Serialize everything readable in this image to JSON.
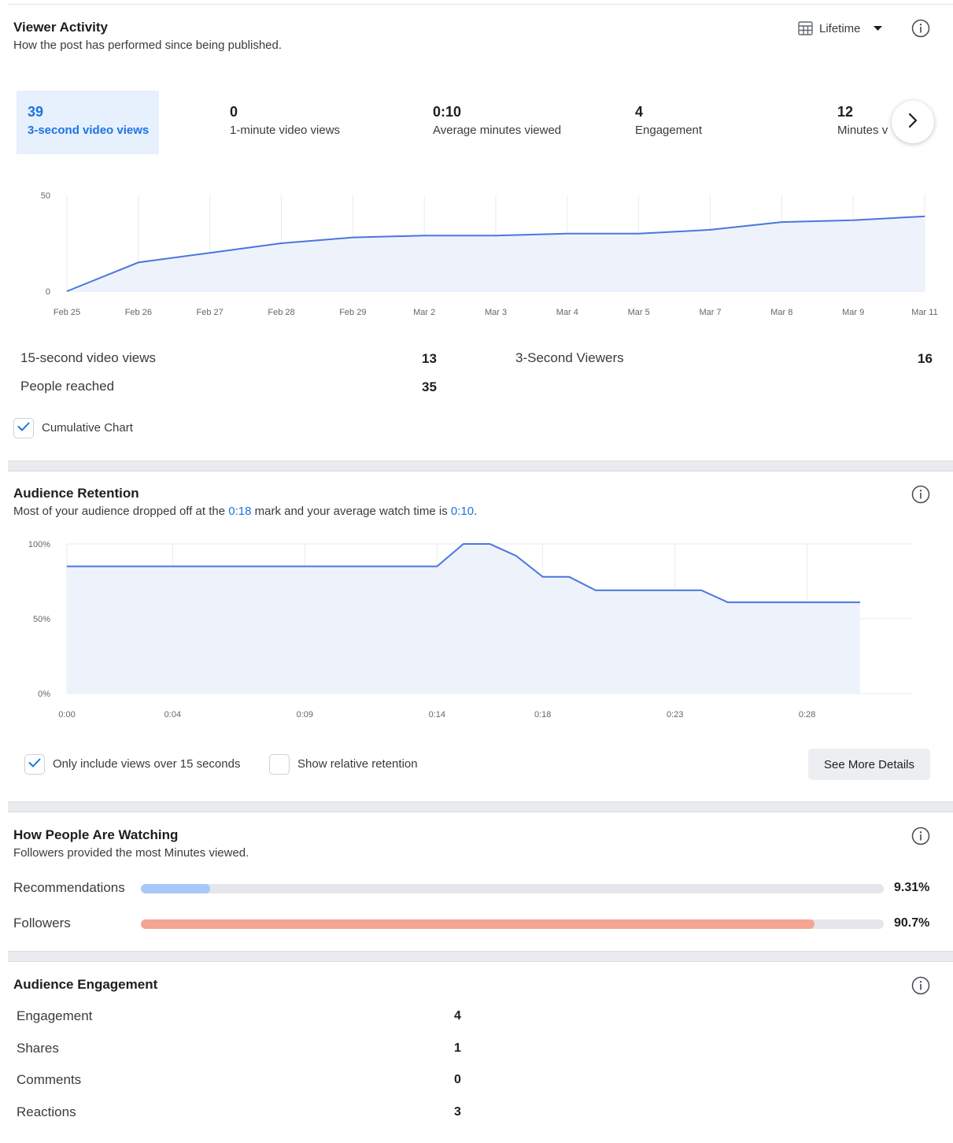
{
  "viewer_activity": {
    "title": "Viewer Activity",
    "subtitle": "How the post has performed since being published.",
    "range_label": "Lifetime",
    "metrics": [
      {
        "value": "39",
        "label": "3-second video views"
      },
      {
        "value": "0",
        "label": "1-minute video views"
      },
      {
        "value": "0:10",
        "label": "Average minutes viewed"
      },
      {
        "value": "4",
        "label": "Engagement"
      },
      {
        "value": "12",
        "label": "Minutes v"
      }
    ],
    "stats": {
      "fifteen_sec_label": "15-second video views",
      "fifteen_sec_value": "13",
      "reached_label": "People reached",
      "reached_value": "35",
      "viewers_label": "3-Second Viewers",
      "viewers_value": "16"
    },
    "cumulative_label": "Cumulative Chart",
    "cumulative_checked": true
  },
  "audience_retention": {
    "title": "Audience Retention",
    "sub_before": "Most of your audience dropped off at the ",
    "sub_mark": "0:18",
    "sub_middle": " mark and your average watch time is ",
    "sub_avg": "0:10",
    "sub_end": ".",
    "only_views_label": "Only include views over 15 seconds",
    "only_views_checked": true,
    "relative_label": "Show relative retention",
    "relative_checked": false,
    "see_more_label": "See More Details"
  },
  "how_watching": {
    "title": "How People Are Watching",
    "subtitle": "Followers provided the most Minutes viewed.",
    "rows": [
      {
        "label": "Recommendations",
        "value": "9.31%",
        "fraction": 0.0931,
        "color": "#a8c7fa"
      },
      {
        "label": "Followers",
        "value": "90.7%",
        "fraction": 0.907,
        "color": "#f4a493"
      }
    ]
  },
  "audience_engagement": {
    "title": "Audience Engagement",
    "rows": [
      {
        "label": "Engagement",
        "value": "4"
      },
      {
        "label": "Shares",
        "value": "1"
      },
      {
        "label": "Comments",
        "value": "0"
      },
      {
        "label": "Reactions",
        "value": "3"
      }
    ]
  },
  "colors": {
    "accent": "#1b74e4",
    "line": "#4a76e0",
    "area": "#eef2fb"
  },
  "chart_data": [
    {
      "type": "area",
      "categories": [
        "Feb 25",
        "Feb 26",
        "Feb 27",
        "Feb 28",
        "Feb 29",
        "Mar 2",
        "Mar 3",
        "Mar 4",
        "Mar 5",
        "Mar 7",
        "Mar 8",
        "Mar 9",
        "Mar 11"
      ],
      "values": [
        0,
        15,
        20,
        25,
        28,
        29,
        29,
        30,
        30,
        32,
        36,
        37,
        39
      ],
      "ylim": [
        0,
        50
      ],
      "yticks": [
        "0",
        "50"
      ],
      "grid": true
    },
    {
      "type": "area",
      "x": [
        0,
        2,
        4,
        6,
        8,
        10,
        12,
        14,
        15,
        16,
        17,
        18,
        19,
        20,
        22,
        24,
        25,
        26,
        28,
        30
      ],
      "values": [
        85,
        85,
        85,
        85,
        85,
        85,
        85,
        85,
        100,
        100,
        92,
        78,
        78,
        69,
        69,
        69,
        61,
        61,
        61,
        61
      ],
      "xticks": [
        "0:00",
        "0:04",
        "0:09",
        "0:14",
        "0:18",
        "0:23",
        "0:28"
      ],
      "xtick_positions": [
        0,
        4,
        9,
        14,
        18,
        23,
        28
      ],
      "xlim": [
        0,
        32
      ],
      "ylim": [
        0,
        100
      ],
      "yticks": [
        "0%",
        "50%",
        "100%"
      ],
      "grid": true
    }
  ]
}
